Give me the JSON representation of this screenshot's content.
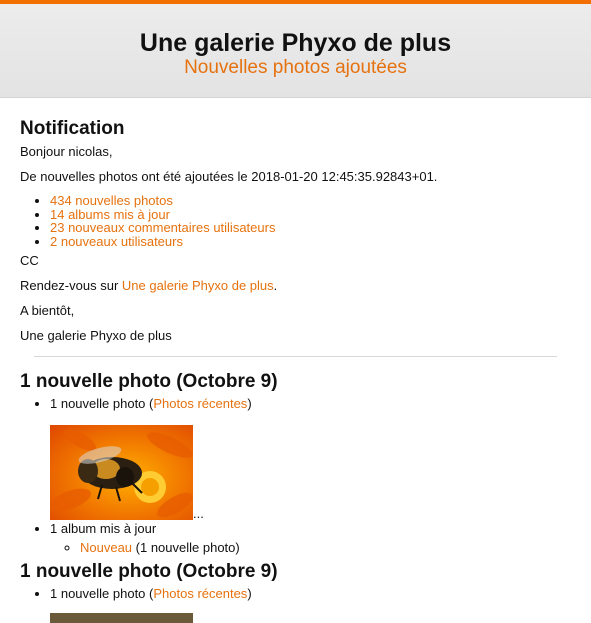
{
  "header": {
    "title": "Une galerie Phyxo de plus",
    "subtitle": "Nouvelles photos ajoutées"
  },
  "notification": {
    "heading": "Notification",
    "greeting": "Bonjour nicolas,",
    "added": "De nouvelles photos ont été ajoutées le 2018-01-20 12:45:35.92843+01.",
    "items": [
      "434 nouvelles photos",
      "14 albums mis à jour",
      "23 nouveaux commentaires utilisateurs",
      "2 nouveaux utilisateurs"
    ],
    "cc": "CC",
    "visit_prefix": "Rendez-vous sur ",
    "visit_link": "Une galerie Phyxo de plus",
    "visit_suffix": ".",
    "bye": "A bientôt,",
    "signature": "Une galerie Phyxo de plus"
  },
  "sections": [
    {
      "heading": "1 nouvelle photo (Octobre 9)",
      "photo_prefix": "1 nouvelle photo (",
      "photo_link": "Photos récentes",
      "photo_suffix": ")",
      "ellipsis": "...",
      "album_line": "1 album mis à jour",
      "album_link": "Nouveau",
      "album_suffix": " (1 nouvelle photo)"
    },
    {
      "heading": "1 nouvelle photo (Octobre 9)",
      "photo_prefix": "1 nouvelle photo (",
      "photo_link": "Photos récentes",
      "photo_suffix": ")"
    }
  ],
  "colors": {
    "accent": "#e6720f",
    "topbar": "#f26f00"
  }
}
